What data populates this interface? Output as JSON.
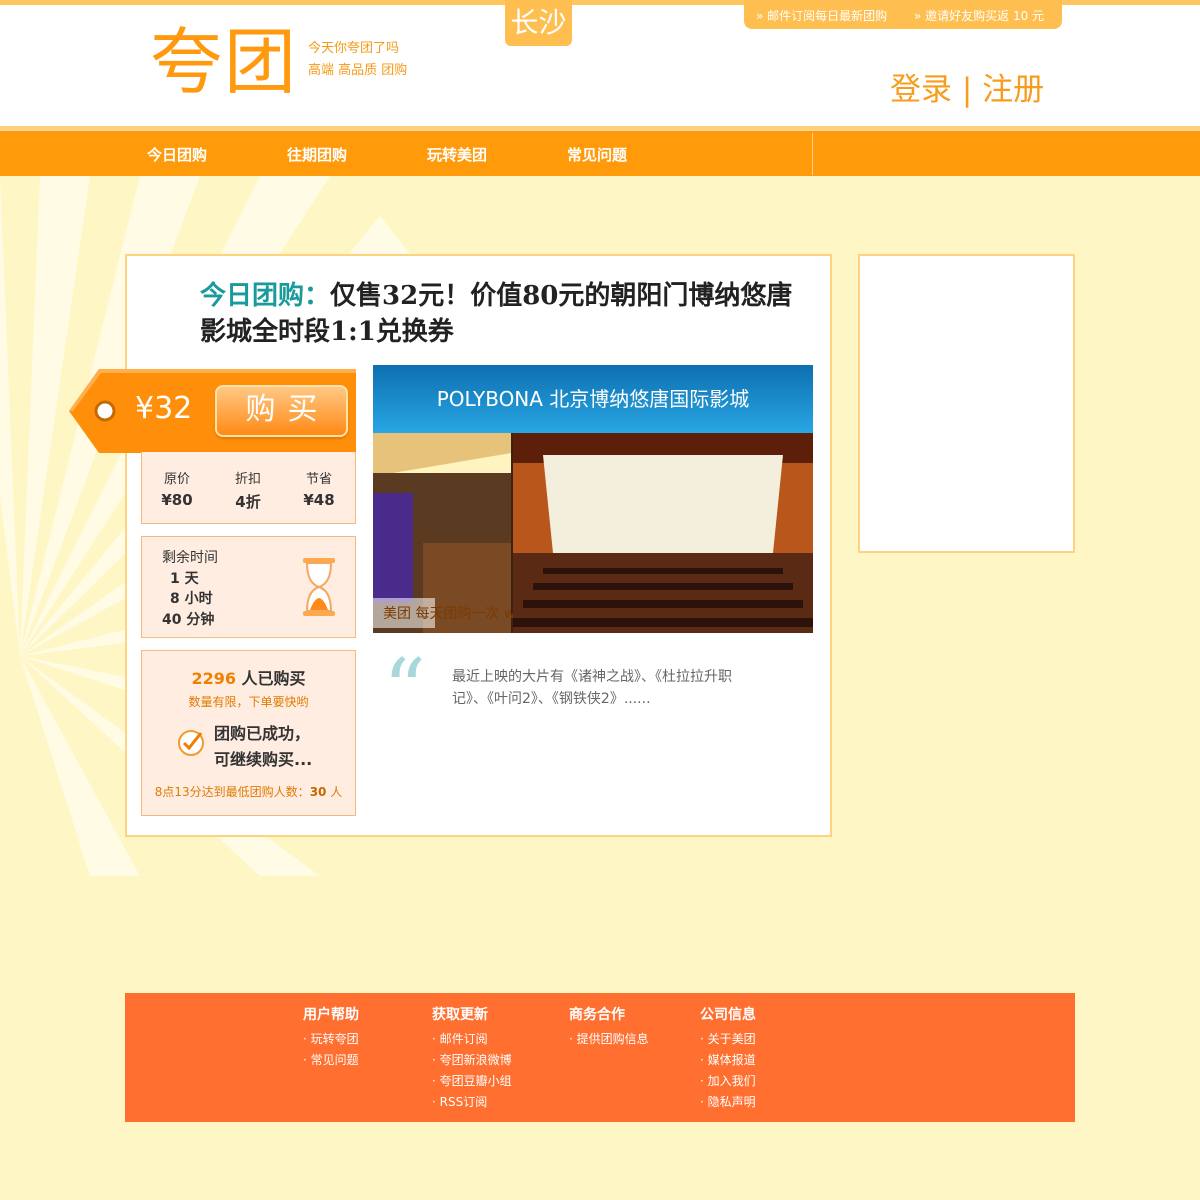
{
  "header": {
    "logo": "夸团",
    "slogan_1": "今天你夸团了吗",
    "slogan_2": "高端 高品质 团购",
    "city": "长沙",
    "top_link_1": "» 邮件订阅每日最新团购",
    "top_link_2": "» 邀请好友购买返 10 元",
    "login": "登录",
    "divider": "|",
    "register": "注册"
  },
  "nav": {
    "items": [
      {
        "label": "今日团购"
      },
      {
        "label": "往期团购"
      },
      {
        "label": "玩转美团"
      },
      {
        "label": "常见问题"
      }
    ]
  },
  "deal": {
    "title_prefix": "今日团购：",
    "title": "仅售32元！价值80元的朝阳门博纳悠唐影城全时段1:1兑换券",
    "price": "¥32",
    "buy_label": "购买",
    "stats": [
      {
        "label": "原价",
        "value": "¥80"
      },
      {
        "label": "折扣",
        "value": "4折"
      },
      {
        "label": "节省",
        "value": "¥48"
      }
    ],
    "timer_label": "剩余时间",
    "days": "1 天",
    "hours": "8 小时",
    "minutes": "40 分钟",
    "buyers_count": "2296",
    "buyers_suffix": " 人已购买",
    "buyers_hint": "数量有限，下单要快哟",
    "success_line_1": "团购已成功，",
    "success_line_2": "可继续购买...",
    "min_reached_text": "8点13分达到最低团购人数：",
    "min_reached_count": "30",
    "min_reached_unit": " 人",
    "image_banner": "POLYBONA 北京博纳悠唐国际影城",
    "image_watermark": "美团 每天团购一次 www.meituan.com",
    "quote": "最近上映的大片有《诸神之战》、《杜拉拉升职记》、《叶问2》、《钢铁侠2》......"
  },
  "footer": {
    "columns": [
      {
        "heading": "用户帮助",
        "links": [
          "· 玩转夸团",
          "· 常见问题"
        ]
      },
      {
        "heading": "获取更新",
        "links": [
          "· 邮件订阅",
          "· 夸团新浪微博",
          "· 夸团豆瓣小组",
          "· RSS订阅"
        ]
      },
      {
        "heading": "商务合作",
        "links": [
          "· 提供团购信息"
        ]
      },
      {
        "heading": "公司信息",
        "links": [
          "· 关于美团",
          "· 媒体报道",
          "· 加入我们",
          "· 隐私声明"
        ]
      }
    ]
  },
  "colors": {
    "accent": "#ff9a0a",
    "footer": "#ff6f30",
    "title_prefix": "#1a9a9a",
    "page_bg": "#fff6c6"
  }
}
